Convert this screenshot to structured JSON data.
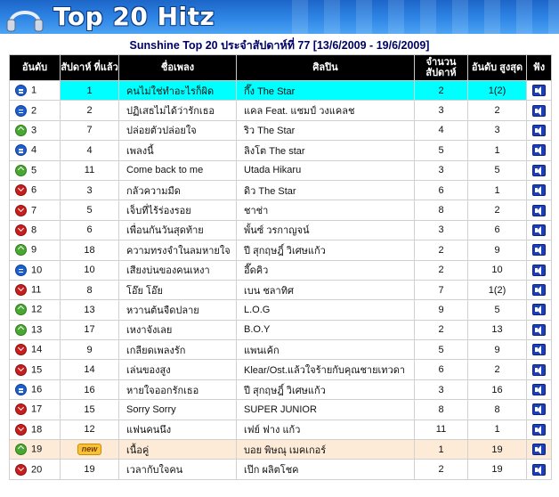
{
  "header": {
    "title": "Top 20 Hitz"
  },
  "table": {
    "caption": "Sunshine Top 20 ประจำสัปดาห์ที่ 77 [13/6/2009 - 19/6/2009]",
    "columns": [
      "อันดับ",
      "สัปดาห์ ที่แล้ว",
      "ชื่อเพลง",
      "ศิลปิน",
      "จำนวน สัปดาห์",
      "อันดับ สูงสุด",
      "ฟัง"
    ],
    "rows": [
      {
        "rank": "1",
        "trend": "same",
        "last": "1",
        "song": "คนไม่ใช่ทำอะไรก็ผิด",
        "artist": "กึ๊ง The Star",
        "weeks": "2",
        "peak": "1(2)"
      },
      {
        "rank": "2",
        "trend": "same",
        "last": "2",
        "song": "ปฏิเสธไม่ได้ว่ารักเธอ",
        "artist": "แคล Feat. แชมป์ วงแคลช",
        "weeks": "3",
        "peak": "2"
      },
      {
        "rank": "3",
        "trend": "up",
        "last": "7",
        "song": "ปล่อยตัวปล่อยใจ",
        "artist": "ริว The Star",
        "weeks": "4",
        "peak": "3"
      },
      {
        "rank": "4",
        "trend": "same",
        "last": "4",
        "song": "เพลงนี้",
        "artist": "ลิงโต The star",
        "weeks": "5",
        "peak": "1"
      },
      {
        "rank": "5",
        "trend": "up",
        "last": "11",
        "song": "Come back to me",
        "artist": "Utada Hikaru",
        "weeks": "3",
        "peak": "5"
      },
      {
        "rank": "6",
        "trend": "down",
        "last": "3",
        "song": "กลัวความมืด",
        "artist": "ดิว The Star",
        "weeks": "6",
        "peak": "1"
      },
      {
        "rank": "7",
        "trend": "down",
        "last": "5",
        "song": "เจ็บที่ไร้ร่องรอย",
        "artist": "ชาช่า",
        "weeks": "8",
        "peak": "2"
      },
      {
        "rank": "8",
        "trend": "down",
        "last": "6",
        "song": "เพื่อนกันวันสุดท้าย",
        "artist": "พั้นซ์ วรกาญจน์",
        "weeks": "3",
        "peak": "6"
      },
      {
        "rank": "9",
        "trend": "up",
        "last": "18",
        "song": "ความทรงจำในลมหายใจ",
        "artist": "ปี สุกฤษฎิ์ วิเศษแก้ว",
        "weeks": "2",
        "peak": "9"
      },
      {
        "rank": "10",
        "trend": "same",
        "last": "10",
        "song": "เสียงบ่นของคนเหงา",
        "artist": "อี๊ดคิว",
        "weeks": "2",
        "peak": "10"
      },
      {
        "rank": "11",
        "trend": "down",
        "last": "8",
        "song": "โอ๊ย โอ๊ย",
        "artist": "เบน ชลาทิศ",
        "weeks": "7",
        "peak": "1(2)"
      },
      {
        "rank": "12",
        "trend": "up",
        "last": "13",
        "song": "หวานต้นจืดปลาย",
        "artist": "L.O.G",
        "weeks": "9",
        "peak": "5"
      },
      {
        "rank": "13",
        "trend": "up",
        "last": "17",
        "song": "เหงาจังเลย",
        "artist": "B.O.Y",
        "weeks": "2",
        "peak": "13"
      },
      {
        "rank": "14",
        "trend": "down",
        "last": "9",
        "song": "เกลียดเพลงรัก",
        "artist": "แพนเค้ก",
        "weeks": "5",
        "peak": "9"
      },
      {
        "rank": "15",
        "trend": "down",
        "last": "14",
        "song": "เล่นของสูง",
        "artist": "Klear/Ost.แล้วใจร้ายกับคุณชายเทวดา",
        "weeks": "6",
        "peak": "2"
      },
      {
        "rank": "16",
        "trend": "same",
        "last": "16",
        "song": "หายใจออกรักเธอ",
        "artist": "ปี สุกฤษฎิ์ วิเศษแก้ว",
        "weeks": "3",
        "peak": "16"
      },
      {
        "rank": "17",
        "trend": "down",
        "last": "15",
        "song": "Sorry Sorry",
        "artist": "SUPER JUNIOR",
        "weeks": "8",
        "peak": "8"
      },
      {
        "rank": "18",
        "trend": "down",
        "last": "12",
        "song": "แฟนคนนึง",
        "artist": "เฟย์ ฟาง แก้ว",
        "weeks": "11",
        "peak": "1"
      },
      {
        "rank": "19",
        "trend": "up",
        "last": "new",
        "song": "เนื้อคู่",
        "artist": "บอย พิษณุ เมคเกอร์",
        "weeks": "1",
        "peak": "19"
      },
      {
        "rank": "20",
        "trend": "down",
        "last": "19",
        "song": "เวลากับใจคน",
        "artist": "เป๊ก ผลิตโชค",
        "weeks": "2",
        "peak": "19"
      }
    ]
  },
  "icons": {
    "same": "equal-icon",
    "up": "up-arrow-icon",
    "down": "down-arrow-icon",
    "listen": "speaker-icon"
  },
  "colors": {
    "highlight": "#00ffff",
    "new_row": "#fdebd8",
    "header_bg": "#000000"
  }
}
